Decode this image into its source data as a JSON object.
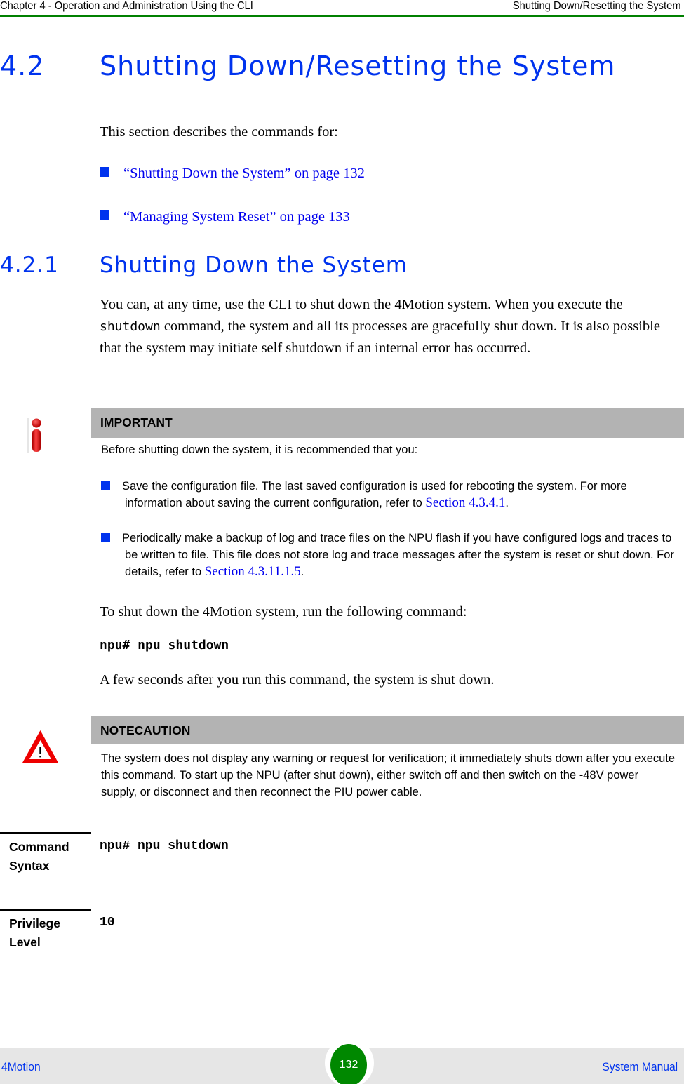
{
  "header": {
    "chapter": "Chapter 4 - Operation and Administration Using the CLI",
    "section": "Shutting Down/Resetting the System",
    "rule_color": "#008000"
  },
  "section": {
    "number": "4.2",
    "title": "Shutting Down/Resetting the System",
    "intro": "This section describes the commands for:",
    "links": [
      {
        "label": "“Shutting Down the System” on page 132"
      },
      {
        "label": "“Managing System Reset” on page 133"
      }
    ]
  },
  "subsection": {
    "number": "4.2.1",
    "title": "Shutting Down the System",
    "para1_before": "You can, at any time, use the CLI to shut down the 4Motion system. When you execute the ",
    "para1_code": "shutdown",
    "para1_after": " command, the system and all its processes are gracefully shut down. It is also possible that the system may initiate self shutdown if an internal error has occurred.",
    "important": {
      "icon": "info-icon",
      "heading": "IMPORTANT",
      "intro": "Before shutting down the system, it is recommended that you:",
      "bullets": [
        {
          "text": "Save the configuration file. The last saved configuration is used for rebooting the system. For more information about saving the current configuration, refer to ",
          "xref": "Section 4.3.4.1",
          "end": "."
        },
        {
          "text": "Periodically make a backup of log and trace files on the NPU flash if you have configured logs and traces to be written to file. This file does not store log and trace messages after the system is reset or shut down. For details, refer to ",
          "xref": "Section 4.3.11.1.5",
          "end": "."
        }
      ]
    },
    "run_text": "To shut down the 4Motion system, run the following command:",
    "command": "npu# npu shutdown",
    "after_text": "A few seconds after you run this command, the system is shut down.",
    "caution": {
      "icon": "warning-icon",
      "heading": "NOTECAUTION",
      "text": "The system does not display any warning or request for verification; it immediately shuts down after you execute this command. To start up the NPU (after shut down), either switch off and then switch on the -48V power supply, or disconnect and then reconnect the PIU power cable."
    },
    "definitions": [
      {
        "label": "Command Syntax",
        "value": "npu# npu shutdown"
      },
      {
        "label": "Privilege Level",
        "value": "10"
      }
    ]
  },
  "footer": {
    "product": "4Motion",
    "page": "132",
    "manual": "System Manual",
    "badge_color": "#008800"
  }
}
